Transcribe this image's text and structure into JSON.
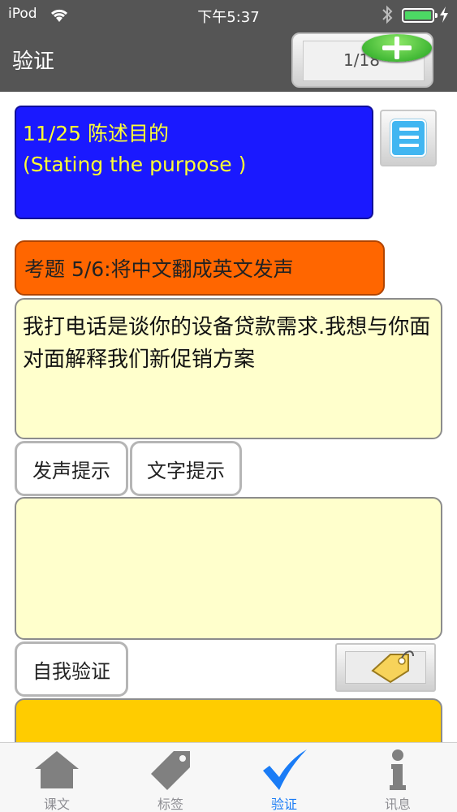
{
  "status_bar": {
    "carrier": "iPod",
    "time": "下午5:37",
    "icons": [
      "wifi-icon",
      "bluetooth-icon",
      "battery-icon",
      "charging-icon"
    ]
  },
  "nav": {
    "title": "验证",
    "page_counter": "1/18",
    "add_icon": "plus-icon"
  },
  "lesson": {
    "title_line1": "11/25 陈述目的",
    "title_line2": "(Stating the purpose )",
    "list_icon": "list-icon"
  },
  "question": {
    "header": "考题 5/6:将中文翻成英文发声",
    "prompt": "我打电话是谈你的设备贷款需求.我想与你面对面解释我们新促销方案"
  },
  "buttons": {
    "voice_hint": "发声提示",
    "text_hint": "文字提示",
    "self_verify": "自我验证",
    "tag_icon": "tag-icon"
  },
  "tabs": [
    {
      "label": "课文",
      "icon": "home-icon",
      "active": false
    },
    {
      "label": "标签",
      "icon": "tag-icon",
      "active": false
    },
    {
      "label": "验证",
      "icon": "checkmark-icon",
      "active": true
    },
    {
      "label": "讯息",
      "icon": "info-icon",
      "active": false
    }
  ],
  "colors": {
    "nav_bar": "#555555",
    "lesson_card": "#1a19ff",
    "lesson_text": "#ffff33",
    "question_header": "#ff6600",
    "prompt_box": "#ffffcc",
    "result_box": "#ffcc00",
    "active_tab": "#1a7cf6"
  }
}
